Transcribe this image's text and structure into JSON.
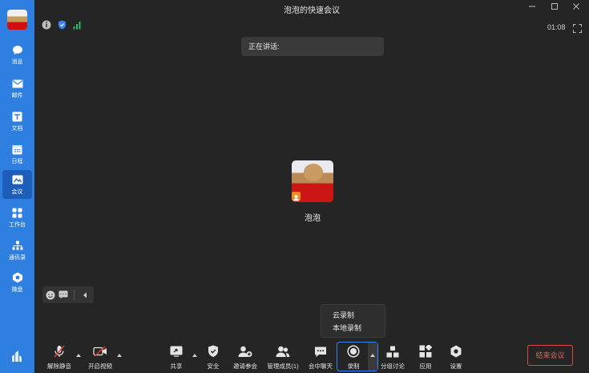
{
  "window": {
    "title": "泡泡的快速会议"
  },
  "sidebar": {
    "items": [
      {
        "label": "消息",
        "icon": "chat-bubble-icon"
      },
      {
        "label": "邮件",
        "icon": "mail-icon"
      },
      {
        "label": "文档",
        "icon": "document-icon"
      },
      {
        "label": "日程",
        "icon": "calendar-icon"
      },
      {
        "label": "会议",
        "icon": "meeting-icon",
        "active": true
      },
      {
        "label": "工作台",
        "icon": "workbench-icon"
      },
      {
        "label": "通讯录",
        "icon": "contacts-icon"
      },
      {
        "label": "微盘",
        "icon": "drive-icon"
      }
    ]
  },
  "status": {
    "time": "01:08"
  },
  "speaking": {
    "text": "正在讲话:"
  },
  "participant": {
    "name": "泡泡"
  },
  "record_menu": {
    "options": [
      "云录制",
      "本地录制"
    ]
  },
  "toolbar": {
    "unmute": "解除静音",
    "start_video": "开启视频",
    "share": "共享",
    "security": "安全",
    "invite": "邀请参会",
    "manage": "管理成员(1)",
    "chat": "会中聊天",
    "record": "录制",
    "breakout": "分组讨论",
    "apps": "应用",
    "settings": "设置",
    "end": "结束会议"
  },
  "colors": {
    "sidebar": "#2f7fe0",
    "accent": "#3b82f6",
    "danger": "#e04848",
    "background": "#252525"
  }
}
